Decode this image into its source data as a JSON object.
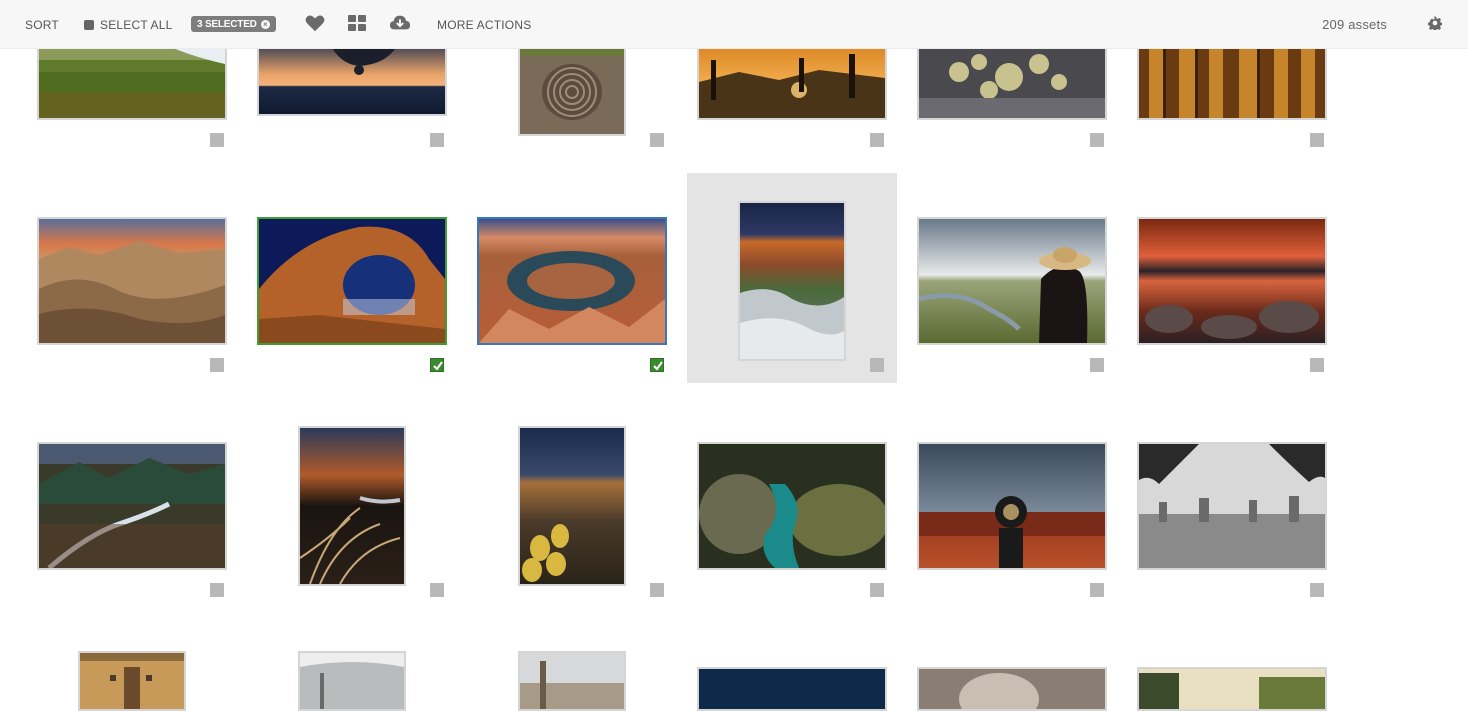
{
  "toolbar": {
    "sort_label": "SORT",
    "select_all_label": "SELECT ALL",
    "selected_badge": "3 SELECTED",
    "more_actions_label": "MORE ACTIONS",
    "asset_count": "209 assets",
    "icons": [
      "heart-icon",
      "grid-view-icon",
      "cloud-download-icon",
      "gear-icon"
    ]
  },
  "colors": {
    "selected_green": "#3f9c35",
    "selected_blue": "#3a76b8",
    "checkbox_checked": "#3a8a2f",
    "checkbox_unchecked": "#b8b8b8",
    "toolbar_bg": "#f7f7f7"
  },
  "assets": [
    {
      "row": 0,
      "col": 0,
      "subject": "green meadow coast",
      "selected": false
    },
    {
      "row": 0,
      "col": 1,
      "subject": "hang glider at sunset over sea",
      "selected": false
    },
    {
      "row": 0,
      "col": 2,
      "subject": "spiral petroglyph",
      "selected": false
    },
    {
      "row": 0,
      "col": 3,
      "subject": "saguaro desert sunset",
      "selected": false
    },
    {
      "row": 0,
      "col": 4,
      "subject": "cholla cactus",
      "selected": false
    },
    {
      "row": 0,
      "col": 5,
      "subject": "saguaro cactus close-up",
      "selected": false
    },
    {
      "row": 1,
      "col": 0,
      "subject": "badlands at sunrise",
      "selected": false
    },
    {
      "row": 1,
      "col": 1,
      "subject": "rock arch at night",
      "selected": true
    },
    {
      "row": 1,
      "col": 2,
      "subject": "horseshoe bend",
      "selected": true
    },
    {
      "row": 1,
      "col": 3,
      "subject": "canyon waterfall",
      "selected": false,
      "hover": true
    },
    {
      "row": 1,
      "col": 4,
      "subject": "woman in hat overlooking river",
      "selected": false
    },
    {
      "row": 1,
      "col": 5,
      "subject": "red sky reflected in lake",
      "selected": false
    },
    {
      "row": 2,
      "col": 0,
      "subject": "mountain stream valley",
      "selected": false
    },
    {
      "row": 2,
      "col": 1,
      "subject": "granite cliff with flowing grass",
      "selected": false
    },
    {
      "row": 2,
      "col": 2,
      "subject": "canyon with prickly pear cactus",
      "selected": false
    },
    {
      "row": 2,
      "col": 3,
      "subject": "mossy gorge with turquoise water",
      "selected": false
    },
    {
      "row": 2,
      "col": 4,
      "subject": "steam locomotive under storm sky",
      "selected": false
    },
    {
      "row": 2,
      "col": 5,
      "subject": "misty pond with trees",
      "selected": false
    },
    {
      "row": 3,
      "col": 0,
      "subject": "train car interior",
      "selected": false
    },
    {
      "row": 3,
      "col": 1,
      "subject": "ceiling interior",
      "selected": false
    },
    {
      "row": 3,
      "col": 2,
      "subject": "city view",
      "selected": false
    },
    {
      "row": 3,
      "col": 3,
      "subject": "night sky",
      "selected": false
    },
    {
      "row": 3,
      "col": 4,
      "subject": "stone sculpture",
      "selected": false
    },
    {
      "row": 3,
      "col": 5,
      "subject": "garden hedge",
      "selected": false
    }
  ]
}
